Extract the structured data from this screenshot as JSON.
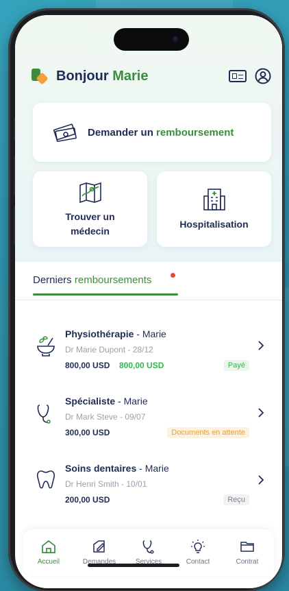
{
  "header": {
    "greeting": "Bonjour",
    "name": "Marie"
  },
  "quick_actions": {
    "refund": {
      "prefix": "Demander un",
      "highlight": "remboursement"
    },
    "doctor": {
      "line1": "Trouver un",
      "line2": "médecin"
    },
    "hospital": {
      "label": "Hospitalisation"
    }
  },
  "section": {
    "title_prefix": "Derniers",
    "title_highlight": "remboursements"
  },
  "reimbursements": [
    {
      "category": "Physiothérapie",
      "person": "Marie",
      "doctor_date": "Dr Marie Dupont - 28/12",
      "amount": "800,00 USD",
      "refunded": "800,00 USD",
      "status": "Payé"
    },
    {
      "category": "Spécialiste",
      "person": "Marie",
      "doctor_date": "Dr Mark Steve - 09/07",
      "amount": "300,00 USD",
      "status": "Documents en attente"
    },
    {
      "category": "Soins dentaires",
      "person": "Marie",
      "doctor_date": "Dr Henri Smith - 10/01",
      "amount": "200,00 USD",
      "status": "Reçu"
    }
  ],
  "nav": [
    {
      "label": "Accueil",
      "icon": "home-icon",
      "active": true
    },
    {
      "label": "Demandes",
      "icon": "edit-icon"
    },
    {
      "label": "Services",
      "icon": "stethoscope-icon"
    },
    {
      "label": "Contact",
      "icon": "lightbulb-icon"
    },
    {
      "label": "Contrat",
      "icon": "folder-icon"
    }
  ],
  "colors": {
    "brand_navy": "#1e2c55",
    "brand_green": "#3a8e3e",
    "accent_orange": "#f0a13a",
    "alert_red": "#e5473b"
  }
}
